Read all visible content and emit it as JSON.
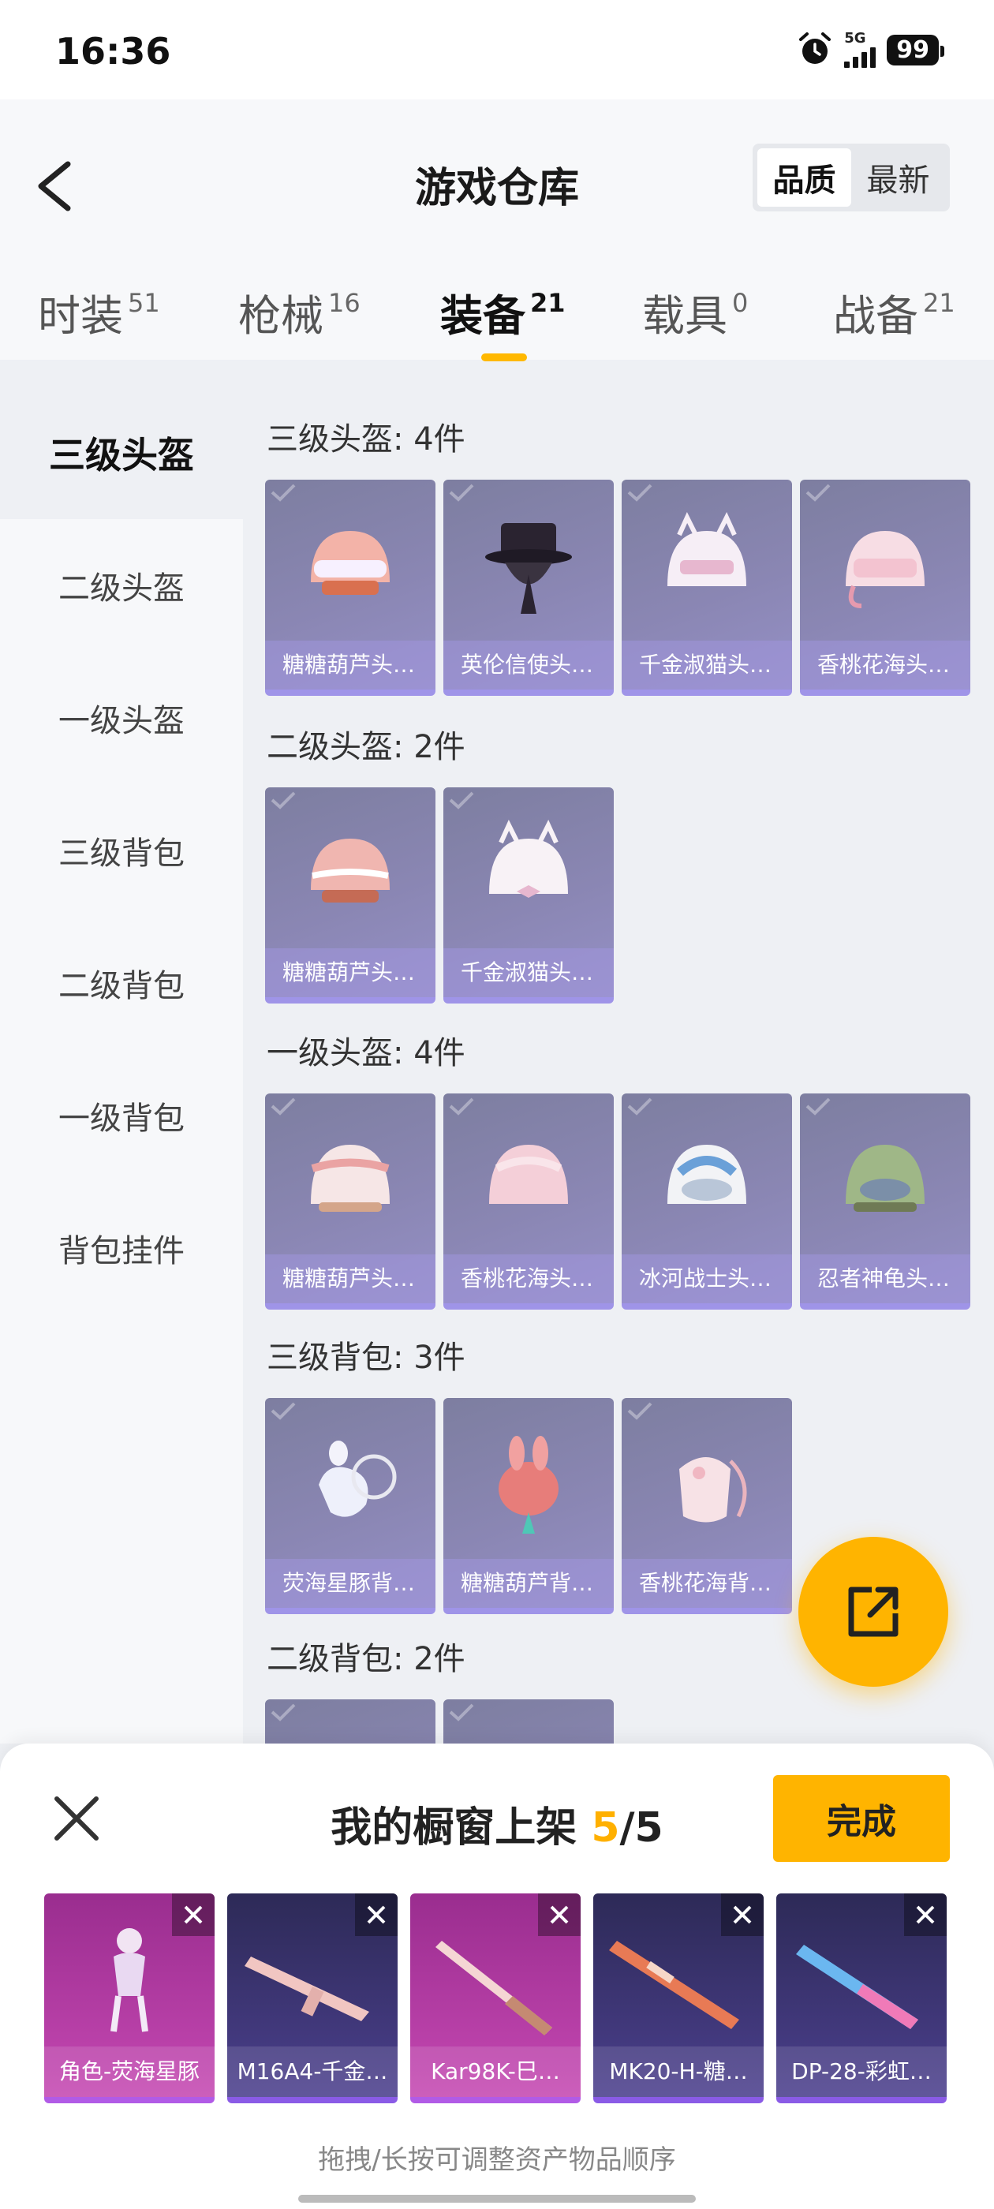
{
  "status": {
    "time": "16:36",
    "network": "5G",
    "battery": "99"
  },
  "header": {
    "title": "游戏仓库",
    "sort_quality": "品质",
    "sort_newest": "最新"
  },
  "tabs": [
    {
      "label": "时装",
      "count": "51"
    },
    {
      "label": "枪械",
      "count": "16"
    },
    {
      "label": "装备",
      "count": "21"
    },
    {
      "label": "载具",
      "count": "0"
    },
    {
      "label": "战备",
      "count": "21"
    }
  ],
  "sidebar": [
    "三级头盔",
    "二级头盔",
    "一级头盔",
    "三级背包",
    "二级背包",
    "一级背包",
    "背包挂件"
  ],
  "sections": [
    {
      "title": "三级头盔: 4件",
      "items": [
        "糖糖葫芦头…",
        "英伦信使头…",
        "千金淑猫头…",
        "香桃花海头…"
      ]
    },
    {
      "title": "二级头盔: 2件",
      "items": [
        "糖糖葫芦头…",
        "千金淑猫头…"
      ]
    },
    {
      "title": "一级头盔: 4件",
      "items": [
        "糖糖葫芦头…",
        "香桃花海头…",
        "冰河战士头…",
        "忍者神龟头…"
      ]
    },
    {
      "title": "三级背包: 3件",
      "items": [
        "荧海星豚背…",
        "糖糖葫芦背…",
        "香桃花海背…"
      ]
    },
    {
      "title": "二级背包: 2件",
      "items": [
        "",
        ""
      ]
    }
  ],
  "showcase": {
    "title_prefix": "我的橱窗上架 ",
    "current": "5",
    "total": "/5",
    "done_label": "完成",
    "slots": [
      "角色-荧海星豚",
      "M16A4-千金…",
      "Kar98K-巳…",
      "MK20-H-糖…",
      "DP-28-彩虹…"
    ],
    "hint": "拖拽/长按可调整资产物品顺序"
  },
  "colors": {
    "accent": "#ffb400",
    "card": "#8a86b3",
    "slot_pink": "#c548b2",
    "slot_blue": "#4b3f8d"
  }
}
